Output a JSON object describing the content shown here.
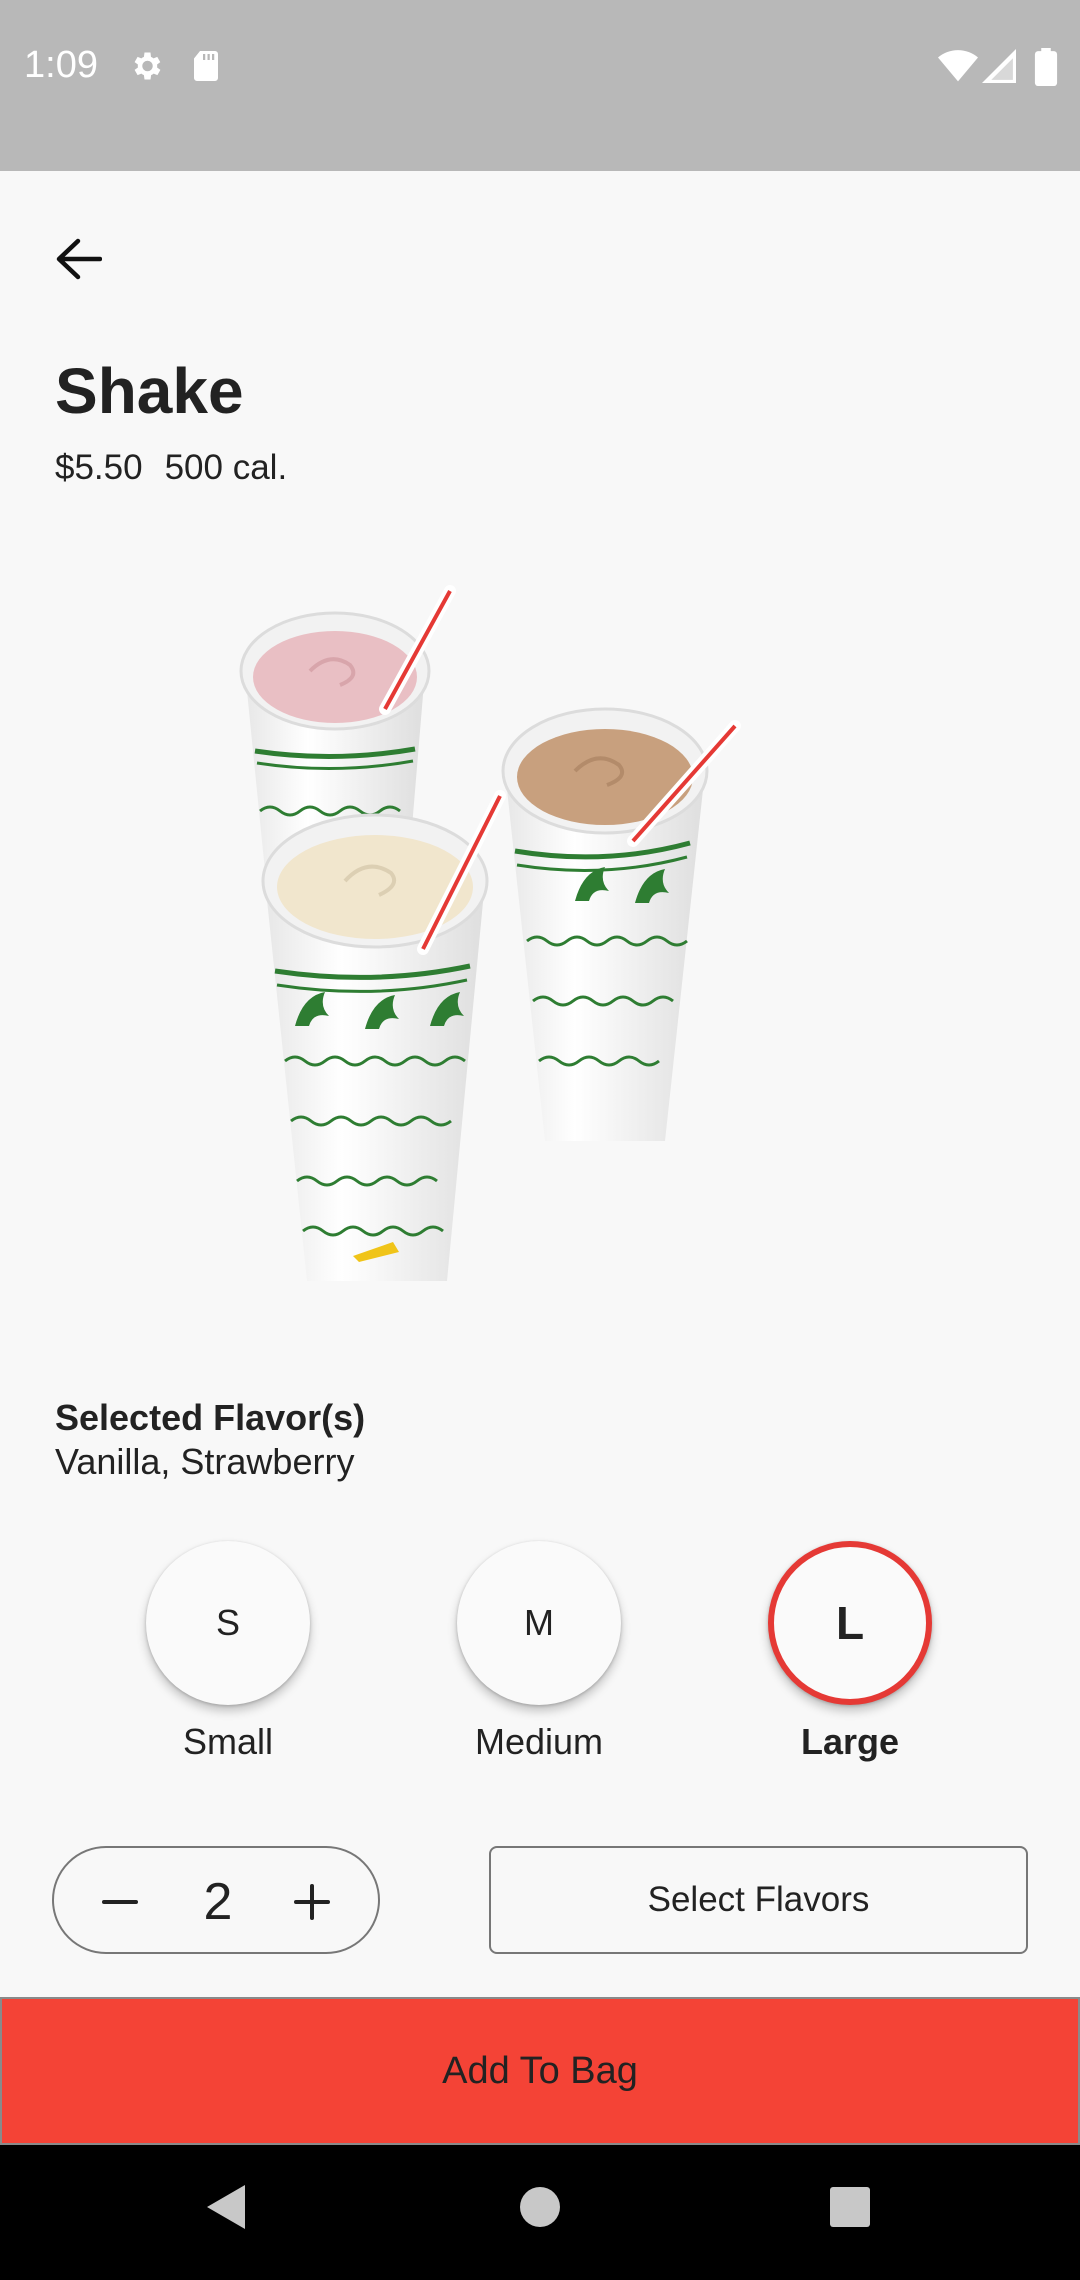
{
  "status_bar": {
    "time": "1:09",
    "icons": [
      "settings-icon",
      "sd-card-icon",
      "wifi-icon",
      "signal-icon",
      "battery-icon"
    ]
  },
  "product": {
    "name": "Shake",
    "price": "$5.50",
    "calories": "500 cal."
  },
  "flavors": {
    "heading": "Selected Flavor(s)",
    "values": "Vanilla, Strawberry"
  },
  "sizes": [
    {
      "letter": "S",
      "label": "Small",
      "selected": false
    },
    {
      "letter": "M",
      "label": "Medium",
      "selected": false
    },
    {
      "letter": "L",
      "label": "Large",
      "selected": true
    }
  ],
  "quantity": {
    "value": "2"
  },
  "actions": {
    "select_flavors": "Select Flavors",
    "add_to_bag": "Add To Bag"
  },
  "colors": {
    "accent": "#f44336",
    "selected_ring": "#e53935",
    "status_bar": "#b8b8b8",
    "background": "#f8f8f8"
  },
  "nav": [
    "back-triangle-icon",
    "home-circle-icon",
    "recents-square-icon"
  ]
}
